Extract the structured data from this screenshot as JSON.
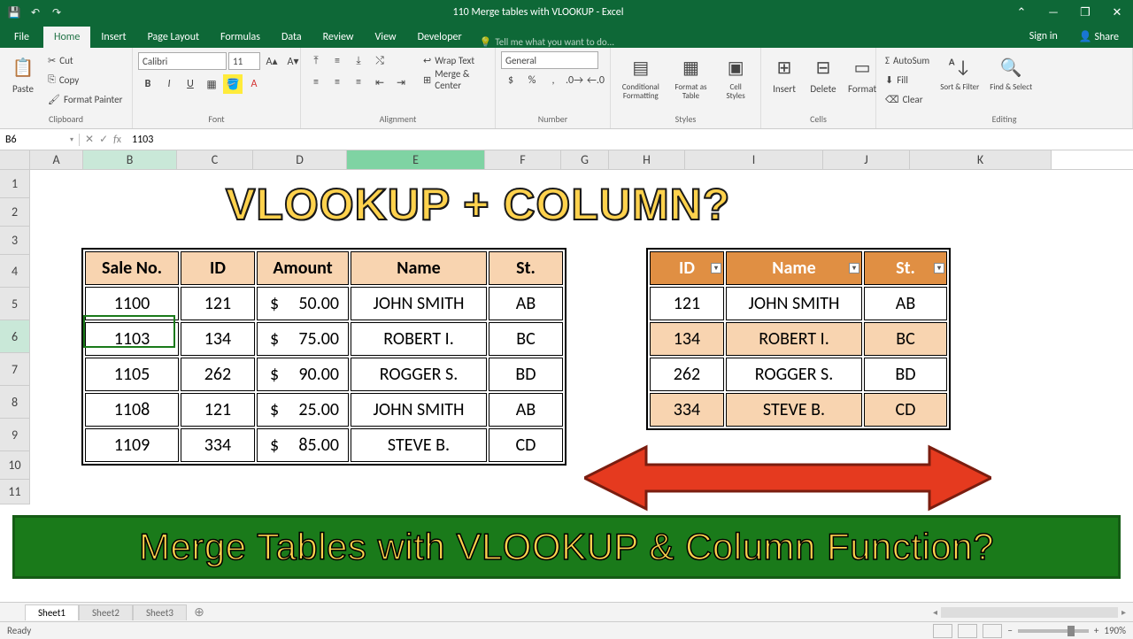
{
  "window": {
    "title": "110 Merge tables with VLOOKUP - Excel",
    "sign_in": "Sign in",
    "share": "Share"
  },
  "tabs": {
    "file": "File",
    "home": "Home",
    "insert": "Insert",
    "page_layout": "Page Layout",
    "formulas": "Formulas",
    "data": "Data",
    "review": "Review",
    "view": "View",
    "developer": "Developer",
    "tell_me": "Tell me what you want to do..."
  },
  "ribbon": {
    "clipboard": {
      "label": "Clipboard",
      "paste": "Paste",
      "cut": "Cut",
      "copy": "Copy",
      "format_painter": "Format Painter"
    },
    "font": {
      "label": "Font",
      "name": "Calibri",
      "size": "11"
    },
    "alignment": {
      "label": "Alignment",
      "wrap": "Wrap Text",
      "merge": "Merge & Center"
    },
    "number": {
      "label": "Number",
      "format": "General"
    },
    "styles": {
      "label": "Styles",
      "cond": "Conditional Formatting",
      "table": "Format as Table",
      "cell": "Cell Styles"
    },
    "cells": {
      "label": "Cells",
      "insert": "Insert",
      "delete": "Delete",
      "format": "Format"
    },
    "editing": {
      "label": "Editing",
      "autosum": "AutoSum",
      "fill": "Fill",
      "clear": "Clear",
      "sort": "Sort & Filter",
      "find": "Find & Select"
    }
  },
  "formula_bar": {
    "name_box": "B6",
    "formula": "1103"
  },
  "columns": [
    "A",
    "B",
    "C",
    "D",
    "E",
    "F",
    "G",
    "H",
    "I",
    "J",
    "K"
  ],
  "rows": [
    "1",
    "2",
    "3",
    "4",
    "5",
    "6",
    "7",
    "8",
    "9",
    "10",
    "11"
  ],
  "big_title": "VLOOKUP + COLUMN?",
  "table1": {
    "headers": [
      "Sale No.",
      "ID",
      "Amount",
      "Name",
      "St."
    ],
    "rows": [
      {
        "sale": "1100",
        "id": "121",
        "amount": "50.00",
        "name": "JOHN SMITH",
        "st": "AB"
      },
      {
        "sale": "1103",
        "id": "134",
        "amount": "75.00",
        "name": "ROBERT I.",
        "st": "BC"
      },
      {
        "sale": "1105",
        "id": "262",
        "amount": "90.00",
        "name": "ROGGER S.",
        "st": "BD"
      },
      {
        "sale": "1108",
        "id": "121",
        "amount": "25.00",
        "name": "JOHN SMITH",
        "st": "AB"
      },
      {
        "sale": "1109",
        "id": "334",
        "amount": "85.00",
        "name": "STEVE B.",
        "st": "CD"
      }
    ]
  },
  "table2": {
    "headers": [
      "ID",
      "Name",
      "St."
    ],
    "rows": [
      {
        "id": "121",
        "name": "JOHN SMITH",
        "st": "AB"
      },
      {
        "id": "134",
        "name": "ROBERT I.",
        "st": "BC"
      },
      {
        "id": "262",
        "name": "ROGGER S.",
        "st": "BD"
      },
      {
        "id": "334",
        "name": "STEVE B.",
        "st": "CD"
      }
    ]
  },
  "banner": "Merge Tables with VLOOKUP & Column Function?",
  "sheets": {
    "s1": "Sheet1",
    "s2": "Sheet2",
    "s3": "Sheet3"
  },
  "status": {
    "ready": "Ready",
    "zoom": "190%"
  }
}
